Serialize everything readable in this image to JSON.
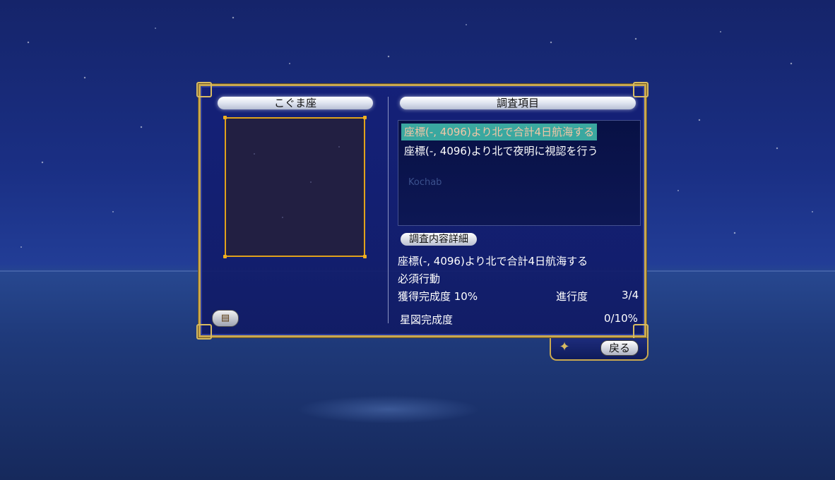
{
  "left_panel": {
    "title": "こぐま座",
    "book_icon": "book-icon"
  },
  "right_panel": {
    "title": "調査項目",
    "tasks": [
      {
        "label": "座標(-, 4096)より北で合計4日航海する",
        "selected": true
      },
      {
        "label": "座標(-, 4096)より北で夜明に視認を行う",
        "selected": false
      }
    ],
    "ghost_label": "Kochab",
    "detail_header": "調査内容詳細",
    "detail_text": "座標(-, 4096)より北で合計4日航海する",
    "required_text": "必須行動",
    "completion_label": "獲得完成度 10%",
    "progress_label": "進行度",
    "progress_value": "3/4",
    "star_chart_label": "星図完成度",
    "star_chart_value": "0/10%"
  },
  "footer": {
    "back_label": "戻る"
  },
  "colors": {
    "frame_gold": "#c9a84f",
    "selected_bg": "#3aa8a0",
    "constellation_border": "#e0a21c"
  }
}
